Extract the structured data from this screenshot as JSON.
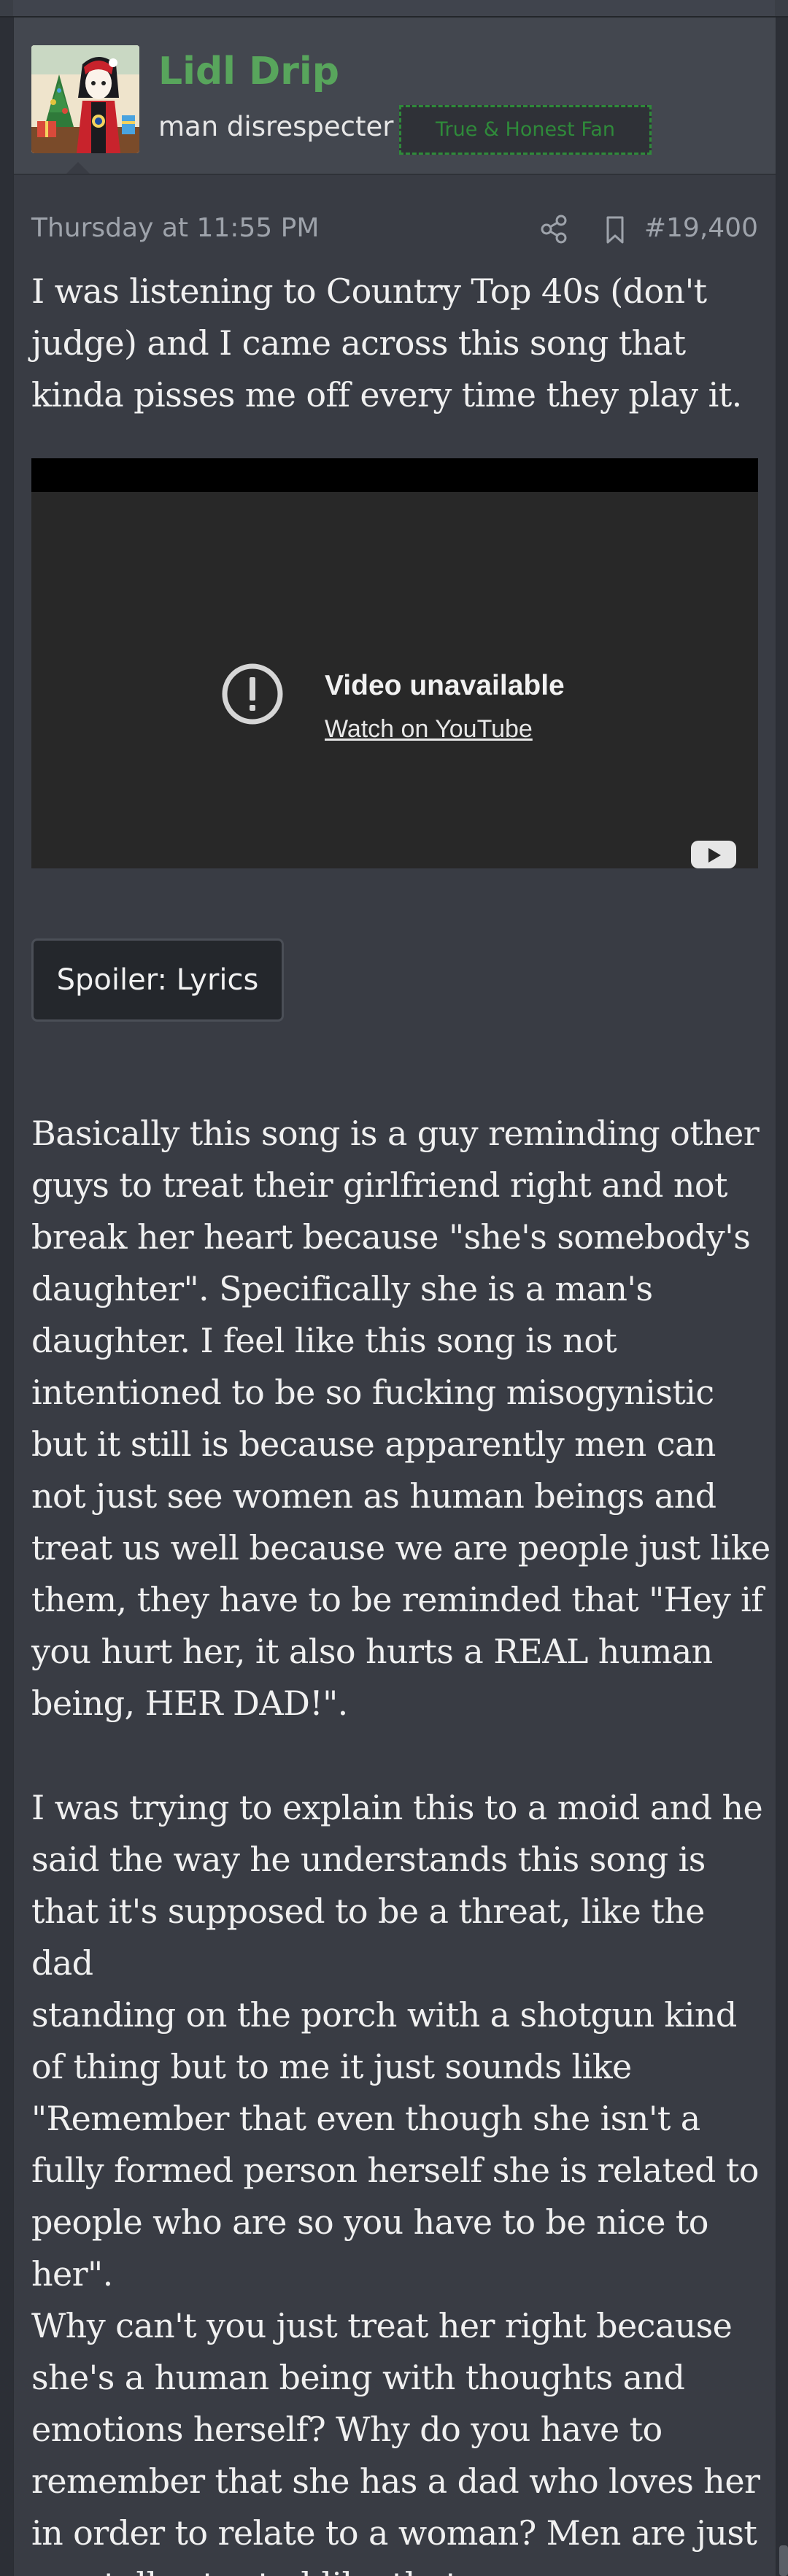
{
  "user": {
    "name": "Lidl Drip",
    "title": "man disrespecter",
    "banner": "True & Honest Fan"
  },
  "meta": {
    "timestamp": "Thursday at 11:55 PM",
    "post_number": "#19,400"
  },
  "icons": {
    "share": "share-icon",
    "bookmark": "bookmark-icon",
    "alert": "exclamation-circle-icon",
    "youtube": "youtube-logo-icon"
  },
  "post": {
    "paragraph_1_lines": [
      "I was listening to Country Top 40s (don't",
      "judge) and I came across this song that",
      "kinda pisses me off every time they play it."
    ],
    "video": {
      "message": "Video unavailable",
      "link": "Watch on YouTube"
    },
    "spoiler_label": "Spoiler: Lyrics",
    "paragraph_2_lines": [
      "Basically this song is a guy reminding other",
      "guys to treat their girlfriend right and not",
      "break her heart because \"she's somebody's",
      "daughter\". Specifically she is a man's",
      "daughter. I feel like this song is not",
      "intentioned to be so fucking misogynistic",
      "but it still is because apparently men can",
      "not just see women as human beings and",
      "treat us well because we are people just like",
      "them, they have to be reminded that \"Hey if",
      "you hurt her, it also hurts a REAL human",
      "being, HER DAD!\"."
    ],
    "paragraph_3_lines": [
      "I was trying to explain this to a moid and he",
      "said the way he understands this song is",
      "that it's supposed to be a threat, like the dad",
      "standing on the porch with a shotgun kind",
      "of thing but to me it just sounds like",
      "\"Remember that even though she isn't a",
      "fully formed person herself she is related to",
      "people who are so you have to be nice to",
      "her\"."
    ],
    "paragraph_4_lines": [
      "Why can't you just treat her right because",
      "she's a human being with thoughts and",
      "emotions herself? Why do you have to",
      "remember that she has a dad who loves her",
      "in order to relate to a woman? Men are just",
      "mentally stunted like that."
    ]
  },
  "colors": {
    "username": "#58a55c",
    "banner": "#2f8a3a",
    "body_text": "#f0f0f0",
    "meta_text": "#9ea3ab",
    "post_bg": "#393c44",
    "header_bg": "#43474f"
  }
}
